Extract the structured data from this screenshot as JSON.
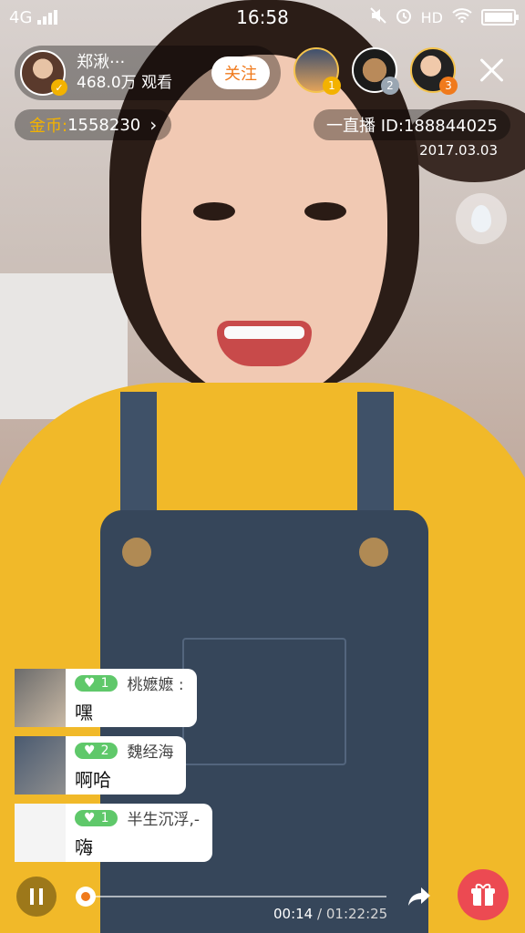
{
  "status_bar": {
    "network": "4G",
    "time": "16:58",
    "hd": "HD"
  },
  "host": {
    "name": "郑湫···",
    "viewers": "468.0万 观看",
    "follow_label": "关注"
  },
  "top_viewers": [
    {
      "rank": "1"
    },
    {
      "rank": "2"
    },
    {
      "rank": "3"
    }
  ],
  "coins": {
    "label": "金币:",
    "value": "1558230",
    "arrow": "›"
  },
  "room": {
    "id_text": "一直播 ID:188844025",
    "date": "2017.03.03"
  },
  "chat": [
    {
      "level": "1",
      "user": "桃嬷嬷 :",
      "text": "嘿"
    },
    {
      "level": "2",
      "user": "魏经海",
      "text": "啊哈"
    },
    {
      "level": "1",
      "user": "半生沉浮,-",
      "text": "嗨"
    }
  ],
  "playback": {
    "current": "00:14",
    "separator": "/",
    "duration": "01:22:25",
    "progress": 0.003
  },
  "colors": {
    "accent": "#f07a1c",
    "level_badge": "#5fc86a",
    "gift": "#ec4a52",
    "coin": "#f3b200"
  }
}
